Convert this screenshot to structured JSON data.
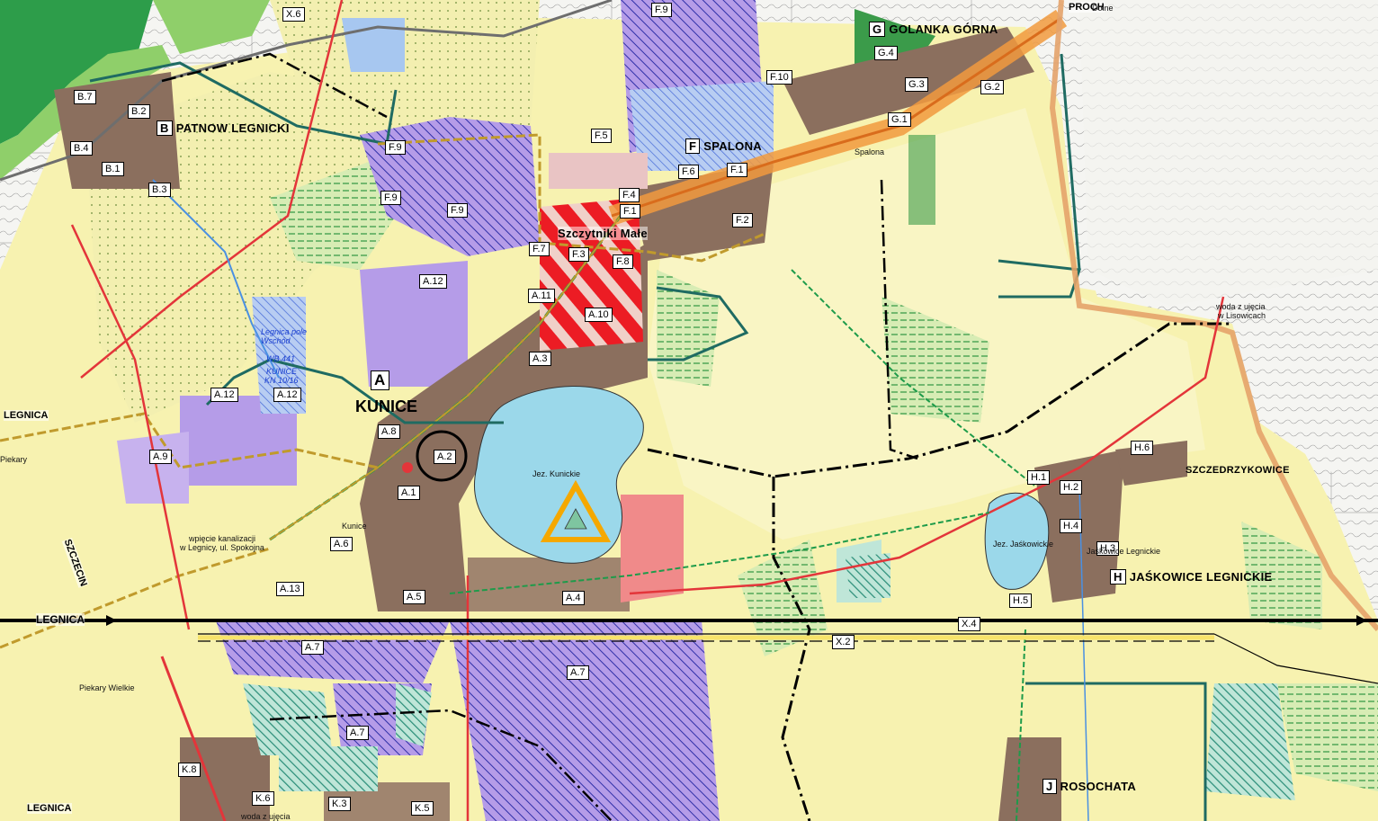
{
  "colors": {
    "residential": "#8b6f5e",
    "industrial_purple": "#a98ee0",
    "service_red": "#e8202a",
    "lake": "#9bd8ea",
    "agriculture": "#f7f2b0",
    "forest": "#2d9d4a",
    "meadow": "#cfe7a0",
    "railway": "#000000",
    "powerline": "#e3353a",
    "boundary": "#c09a2c"
  },
  "places": {
    "patnow": {
      "code": "B",
      "name": "PATNOW LEGNICKI"
    },
    "spalona": {
      "code": "F",
      "name": "SPALONA"
    },
    "golanka": {
      "code": "G",
      "name": "GOLANKA GÓRNA"
    },
    "kunice": {
      "code": "A",
      "name": "KUNICE"
    },
    "jaskowice": {
      "code": "H",
      "name": "JAŚKOWICE LEGNICKIE"
    },
    "rosochata": {
      "code": "J",
      "name": "ROSOCHATA"
    },
    "szczytniki": {
      "name": "Szczytniki Małe"
    },
    "szczedrzykowice": {
      "name": "SZCZEDRZYKOWICE"
    }
  },
  "zone_labels": [
    "B.7",
    "B.2",
    "B.4",
    "B.1",
    "B.3",
    "F.9",
    "F.9",
    "F.9",
    "F.9",
    "F.10",
    "F.5",
    "F.6",
    "F.1",
    "F.4",
    "F.1",
    "F.2",
    "F.7",
    "F.3",
    "F.8",
    "G.4",
    "G.3",
    "G.2",
    "G.1",
    "A.12",
    "A.12",
    "A.12",
    "A.11",
    "A.10",
    "A.3",
    "A.8",
    "A.2",
    "A.9",
    "A.1",
    "A.6",
    "A.13",
    "A.5",
    "A.4",
    "A.7",
    "A.7",
    "A.7",
    "H.6",
    "H.1",
    "H.2",
    "H.4",
    "H.3",
    "H.5",
    "K.8",
    "K.6",
    "K.3",
    "K.5",
    "X.6",
    "X.4",
    "X.2"
  ],
  "road_labels": {
    "legnica_w": "LEGNICA",
    "legnica_sw": "LEGNICA",
    "legnica_bottom": "LEGNICA",
    "szczecin": "SZCZECIN",
    "proch": "PROCH"
  },
  "annotations": {
    "lake_kunickie": "Jez. Kunickie",
    "lake_jaskowickie": "Jez. Jaśkowickie",
    "woda_1": "woda z ujęcia",
    "woda_2": "w Lisowicach",
    "piekary": "Piekary Wielkie",
    "piekary2": "Piekary",
    "kanal_1": "wpięcie kanalizacji",
    "kanal_2": "w Legnicy, ul. Spokojna",
    "kunice_small": "Kunice",
    "wo_1": "Legnica pole",
    "wo_2": "Wschód",
    "wo_3": "WB 441",
    "wo_4": "KUNICE",
    "wo_5": "KN 10/16",
    "dolne": "Dolne",
    "spalona_small": "Spalona",
    "jaskowice_small": "Jaśkowice Legnickie",
    "woda_z_ujecia_bottom": "woda z ujęcia"
  }
}
